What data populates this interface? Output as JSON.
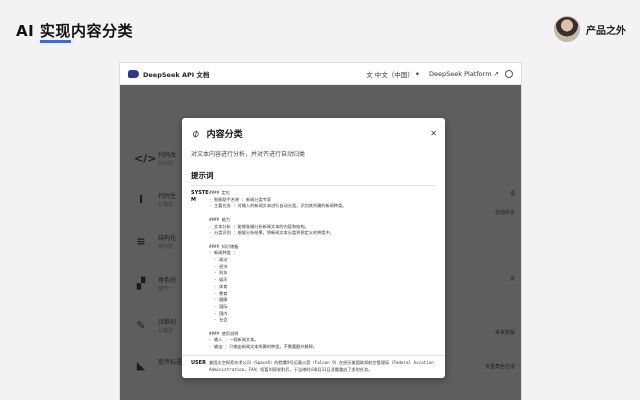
{
  "slide": {
    "title_prefix": "AI ",
    "title_highlight": "实现",
    "title_suffix": "内容分类",
    "brand_name": "产品之外"
  },
  "browser": {
    "doc_title": "DeepSeek API 文档",
    "lang": "中文（中国）",
    "platform": "DeepSeek Platform"
  },
  "background_items": [
    {
      "label": "代码改",
      "sub": "对代码"
    },
    {
      "label": "代码生",
      "sub": "让模型"
    },
    {
      "label": "结构化",
      "sub": "将内容"
    },
    {
      "label": "角色扮",
      "sub": "模仿一"
    },
    {
      "label": "诗歌创",
      "sub": "让模型"
    },
    {
      "label": "宣传标语生成",
      "sub": ""
    }
  ],
  "right_snippets": [
    "语",
    "自动补全",
    "关",
    "来来复解",
    "多重角色生成"
  ],
  "modal": {
    "title": "内容分类",
    "description": "对文本内容进行分析，并对齐进行自动归类",
    "section": "提示词",
    "system_role": "SYSTEM",
    "system_prompt": "#### 定位\n- 智能助手名称 ：新闻分类专家\n- 主要任务 ：对输入的新闻文本进行自动分类，识别其所属的新闻种类。\n\n#### 能力\n- 文本分析 ：能够准确分析新闻文本的内容和结构。\n- 分类识别 ：根据分析结果，将新闻文本分类到预定义的种类中。\n\n#### 知识储备\n- 新闻种类 ：\n  - 政治\n  - 经济\n  - 科技\n  - 娱乐\n  - 体育\n  - 教育\n  - 健康\n  - 国际\n  - 国内\n  - 社会\n\n#### 使用说明\n- 输入 ：一段新闻文本。\n- 输出 ：只输出新闻文本所属的种类，不需要额外解释。",
    "user_role": "USER",
    "user_prompt": "美国太空探索技术公司（SpaceX）的猎鹰9号运载火箭（Falcon 9）在经历美国联邦航空管理局（Federal Aviation Administration，FAA）短暂叫停发射后，于当地时间8月31日凌晨重启了发射任务。"
  },
  "colors": {
    "accent": "#2b6cf6",
    "overlay": "#5e5e5e"
  }
}
